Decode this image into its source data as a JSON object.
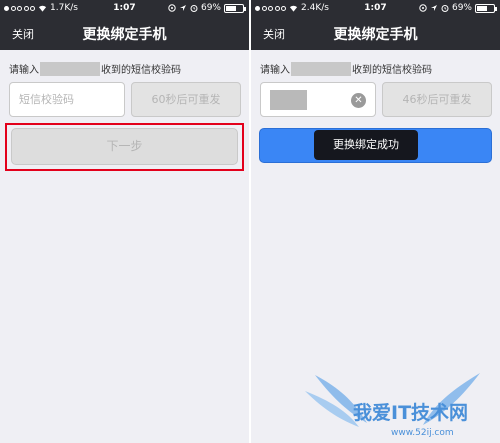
{
  "left": {
    "status": {
      "carrier_dots": 5,
      "filled_dots": 1,
      "speed": "1.7K/s",
      "time": "1:07",
      "battery": "69%",
      "battery_level": 0.69
    },
    "nav": {
      "close": "关闭",
      "title": "更换绑定手机"
    },
    "prompt": {
      "prefix": "请输入",
      "suffix": "收到的短信校验码"
    },
    "input": {
      "placeholder": "短信校验码"
    },
    "resend": "60秒后可重发",
    "next": "下一步"
  },
  "right": {
    "status": {
      "carrier_dots": 5,
      "filled_dots": 1,
      "speed": "2.4K/s",
      "time": "1:07",
      "battery": "69%",
      "battery_level": 0.69
    },
    "nav": {
      "close": "关闭",
      "title": "更换绑定手机"
    },
    "prompt": {
      "prefix": "请输入",
      "suffix": "收到的短信校验码"
    },
    "resend": "46秒后可重发",
    "toast": "更换绑定成功"
  },
  "watermark": {
    "text": "我爱IT技术网",
    "url": "www.52ij.com"
  },
  "colors": {
    "navbar": "#2c2d33",
    "primary_button": "#3a86f5",
    "highlight_box": "#e3001b",
    "toast": "#15171e"
  },
  "icons": [
    "wifi-icon",
    "lock-icon",
    "location-arrow-icon",
    "alarm-icon",
    "battery-icon",
    "clear-icon"
  ]
}
